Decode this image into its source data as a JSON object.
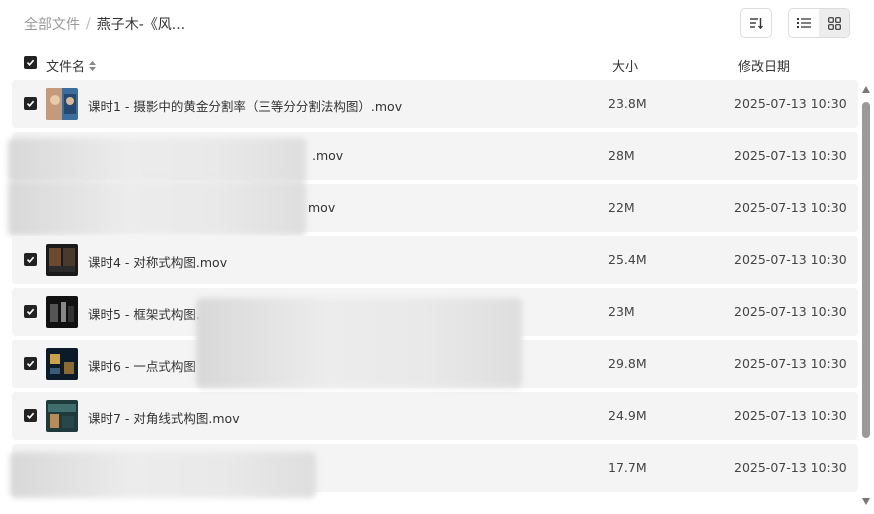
{
  "breadcrumb": {
    "root": "全部文件",
    "separator": "/",
    "current": "燕子木-《风..."
  },
  "toolbar": {
    "sort_icon": "sort-icon",
    "list_view_icon": "list-view-icon",
    "grid_view_icon": "grid-view-icon",
    "active_view": "list"
  },
  "columns": {
    "name": "文件名",
    "size": "大小",
    "date": "修改日期"
  },
  "files": [
    {
      "name": "课时1 - 摄影中的黄金分割率（三等分分割法构图）.mov",
      "size": "23.8M",
      "date": "2025-07-13 10:30",
      "checked": true
    },
    {
      "name": ".mov",
      "size": "28M",
      "date": "2025-07-13 10:30",
      "checked": false
    },
    {
      "name": "mov",
      "size": "22M",
      "date": "2025-07-13 10:30",
      "checked": false
    },
    {
      "name": "课时4 - 对称式构图.mov",
      "size": "25.4M",
      "date": "2025-07-13 10:30",
      "checked": true
    },
    {
      "name": "课时5 - 框架式构图.",
      "size": "23M",
      "date": "2025-07-13 10:30",
      "checked": true
    },
    {
      "name": "课时6 - 一点式构图",
      "size": "29.8M",
      "date": "2025-07-13 10:30",
      "checked": true
    },
    {
      "name": "课时7 - 对角线式构图.mov",
      "size": "24.9M",
      "date": "2025-07-13 10:30",
      "checked": true
    },
    {
      "name": "",
      "size": "17.7M",
      "date": "2025-07-13 10:30",
      "checked": false
    }
  ],
  "colors": {
    "row_bg": "#f4f4f4",
    "checkbox": "#222222",
    "scrollbar": "#9a9a9a"
  }
}
